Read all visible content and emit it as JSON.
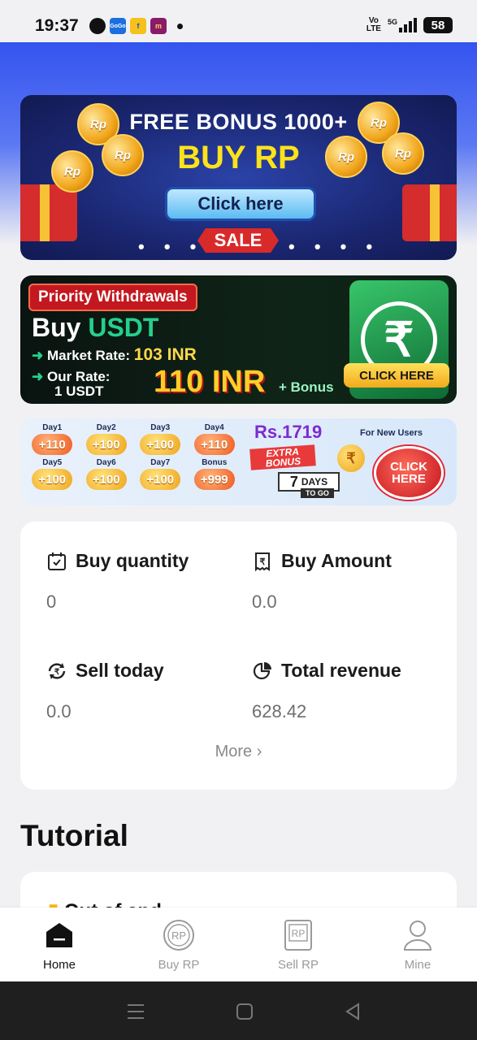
{
  "status_bar": {
    "time": "19:37",
    "apps": [
      {
        "icon": "chat-bubble-icon",
        "label": ""
      },
      {
        "icon": "gogo-app-icon",
        "label": "GoGo"
      },
      {
        "icon": "flipkart-app-icon",
        "label": "f"
      },
      {
        "icon": "meesho-app-icon",
        "label": "m"
      }
    ],
    "volte_line1": "Vo",
    "volte_line2": "LTE",
    "network": "5G",
    "battery": "58"
  },
  "banners": {
    "bonus": {
      "headline": "FREE BONUS 1000+",
      "title": "BUY RP",
      "button": "Click here",
      "sale": "SALE",
      "coin_label": "Rp"
    },
    "usdt": {
      "tag": "Priority Withdrawals",
      "buy": "Buy",
      "buy_highlight": "USDT",
      "market_label": "Market Rate:",
      "market_value": "103 INR",
      "our_label": "Our Rate:",
      "our_unit": "1 USDT",
      "our_value": "110 INR",
      "bonus": "+ Bonus",
      "click": "CLICK HERE",
      "logo": "₹"
    },
    "checkin": {
      "days": [
        {
          "day": "Day1",
          "amount": "+110",
          "style": "red"
        },
        {
          "day": "Day2",
          "amount": "+100",
          "style": "gold"
        },
        {
          "day": "Day3",
          "amount": "+100",
          "style": "gold"
        },
        {
          "day": "Day4",
          "amount": "+110",
          "style": "red"
        },
        {
          "day": "Day5",
          "amount": "+100",
          "style": "gold"
        },
        {
          "day": "Day6",
          "amount": "+100",
          "style": "gold"
        },
        {
          "day": "Day7",
          "amount": "+100",
          "style": "gold"
        },
        {
          "day": "Bonus",
          "amount": "+999",
          "style": "red"
        }
      ],
      "reward": "Rs.1719",
      "for_new": "For New Users",
      "extra": "EXTRA BONUS",
      "days_num": "7",
      "days_word": "DAYS",
      "to_go": "TO GO",
      "rupee": "₹",
      "click": "CLICK HERE"
    }
  },
  "stats": {
    "buy_quantity": {
      "label": "Buy quantity",
      "value": "0",
      "icon": "calendar-icon"
    },
    "buy_amount": {
      "label": "Buy Amount",
      "value": "0.0",
      "icon": "receipt-icon"
    },
    "sell_today": {
      "label": "Sell today",
      "value": "0.0",
      "icon": "exchange-icon"
    },
    "total_revenue": {
      "label": "Total revenue",
      "value": "628.42",
      "icon": "pie-chart-icon"
    },
    "more": "More"
  },
  "tutorial": {
    "title": "Tutorial",
    "first_item": "Out of and"
  },
  "bottom_nav": [
    {
      "label": "Home",
      "icon": "home-icon",
      "active": true
    },
    {
      "label": "Buy RP",
      "icon": "buy-rp-icon",
      "active": false
    },
    {
      "label": "Sell RP",
      "icon": "sell-rp-icon",
      "active": false
    },
    {
      "label": "Mine",
      "icon": "user-icon",
      "active": false
    }
  ],
  "colors": {
    "accent_blue": "#3454ef",
    "usdt_green": "#25d08c",
    "page_bg": "#f1f1f3"
  }
}
